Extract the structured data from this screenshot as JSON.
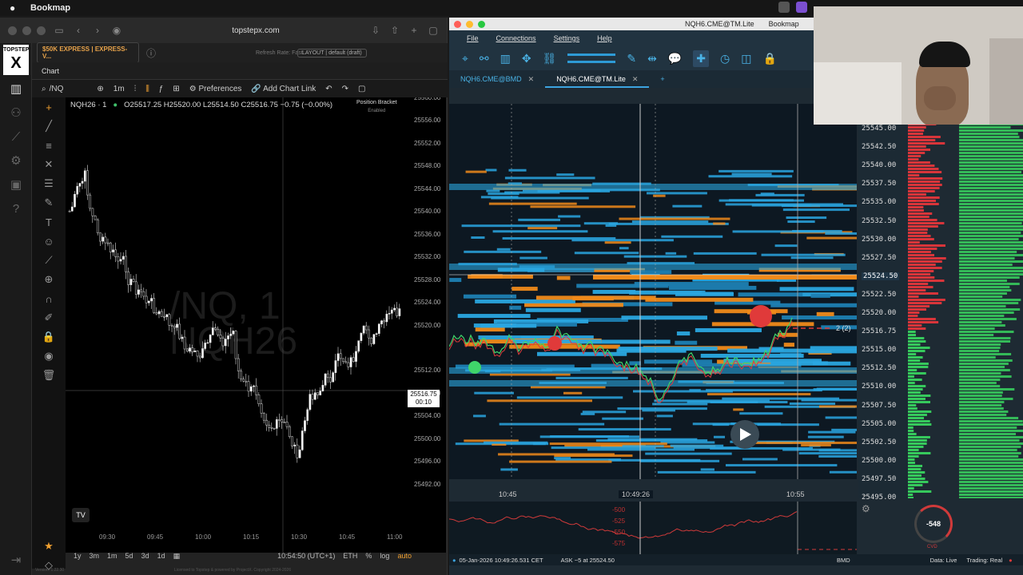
{
  "menubar": {
    "app_name": "Bookmap"
  },
  "browser": {
    "url": "topstepx.com",
    "logo_top": "TOPSTEP",
    "logo_mark": "X",
    "account": "$50K EXPRESS | EXPRESS-V...",
    "refresh_rate": "Refresh Rate: Fast",
    "layout": "LAYOUT | default (draft)",
    "chart_tab": "Chart",
    "symbol": "/NQ",
    "interval": "1m",
    "preferences": "Preferences",
    "add_chart_link": "Add Chart Link",
    "ohlc_symbol": "NQH26 · 1",
    "ohlc_values": "O25517.25 H25520.00 L25514.50 C25516.75 −0.75 (−0.00%)",
    "position_bracket": "Position Bracket",
    "position_bracket_state": "Enabled",
    "watermark_line1": "/NQ, 1",
    "watermark_line2": "NQH26",
    "price_labels": [
      "25560.00",
      "25556.00",
      "25552.00",
      "25548.00",
      "25544.00",
      "25540.00",
      "25536.00",
      "25532.00",
      "25528.00",
      "25524.00",
      "25520.00",
      "25512.00",
      "25508.00",
      "25504.00",
      "25500.00",
      "25496.00",
      "25492.00"
    ],
    "current_price": "25516.75",
    "current_countdown": "00:10",
    "time_labels": [
      "09:30",
      "09:45",
      "10:00",
      "10:15",
      "10:30",
      "10:45",
      "11:00"
    ],
    "ranges": [
      "1y",
      "3m",
      "1m",
      "5d",
      "3d",
      "1d"
    ],
    "clock": "10:54:50 (UTC+1)",
    "session": "ETH",
    "pct": "%",
    "log": "log",
    "auto": "auto",
    "license": "Licensed to Topstep & powered by ProjectX. Copyright 2024-2026",
    "version": "Version: 1.22.30"
  },
  "bookmap": {
    "window_title": "NQH6.CME@TM.Lite",
    "window_app": "Bookmap",
    "menu": [
      "File",
      "Connections",
      "Settings",
      "Help"
    ],
    "tabs": [
      {
        "label": "NQH6.CME@BMD",
        "active": false
      },
      {
        "label": "NQH6.CME@TM.Lite",
        "active": true
      }
    ],
    "add_tab": "+",
    "prices": [
      "25545.00",
      "25542.50",
      "25540.00",
      "25537.50",
      "25535.00",
      "25532.50",
      "25530.00",
      "25527.50",
      "25524.50",
      "25522.50",
      "25520.00",
      "25516.75",
      "25515.00",
      "25512.50",
      "25510.00",
      "25507.50",
      "25505.00",
      "25502.50",
      "25500.00",
      "25497.50",
      "25495.00"
    ],
    "current_price": "25524.50",
    "last_price": "25516.75",
    "position_marker": "2 (2)",
    "time_labels": [
      "10:45",
      "10:49:26",
      "10:55"
    ],
    "cvd_labels": [
      "-500",
      "-525",
      "-550",
      "-575"
    ],
    "cvd_value": "-548",
    "cvd_label": "CVD",
    "status_datetime": "05-Jan-2026 10:49:26.531 CET",
    "status_ask": "ASK ~5 at 25524.50",
    "status_feed": "BMD",
    "status_data": "Data: Live",
    "status_trading": "Trading: Real",
    "colors": {
      "bid": "#2aa6e0",
      "ask": "#f08a1a",
      "buy": "#3fd46a",
      "sell": "#e03a3a"
    }
  }
}
